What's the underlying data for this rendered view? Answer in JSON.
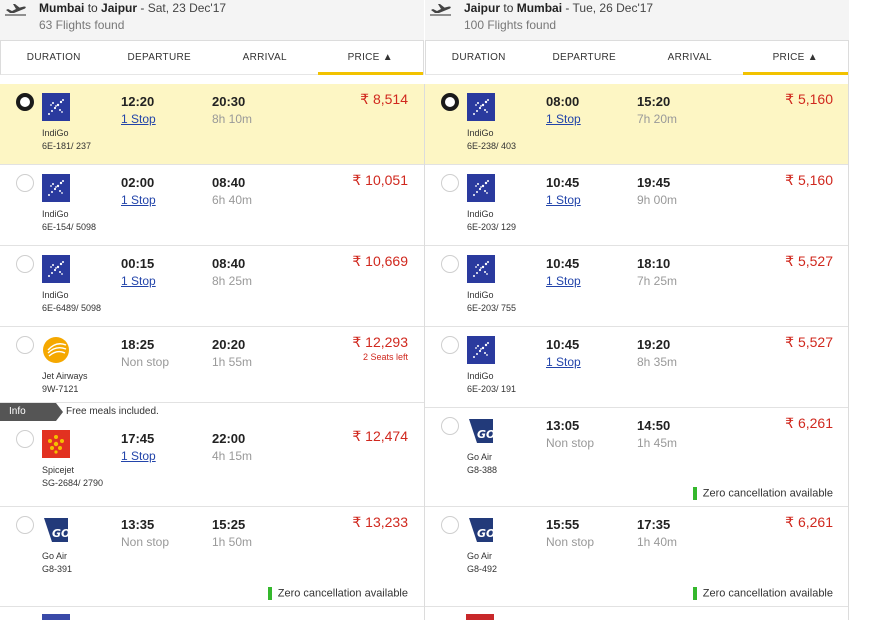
{
  "outbound": {
    "from": "Mumbai",
    "connector": "to",
    "to": "Jaipur",
    "date": "Sat, 23 Dec'17",
    "count": "63 Flights found",
    "sort": [
      "DURATION",
      "DEPARTURE",
      "ARRIVAL",
      "PRICE ▲"
    ],
    "flights": [
      {
        "airline": "IndiGo",
        "flight": "6E-181/ 237",
        "dep": "12:20",
        "arr": "20:30",
        "stops": "1 Stop",
        "dur": "8h 10m",
        "price": "₹ 8,514",
        "selected": true,
        "logo": "indigo"
      },
      {
        "airline": "IndiGo",
        "flight": "6E-154/ 5098",
        "dep": "02:00",
        "arr": "08:40",
        "stops": "1 Stop",
        "dur": "6h 40m",
        "price": "₹ 10,051",
        "logo": "indigo"
      },
      {
        "airline": "IndiGo",
        "flight": "6E-6489/ 5098",
        "dep": "00:15",
        "arr": "08:40",
        "stops": "1 Stop",
        "dur": "8h 25m",
        "price": "₹ 10,669",
        "logo": "indigo"
      },
      {
        "airline": "Jet Airways",
        "flight": "9W-7121",
        "dep": "18:25",
        "arr": "20:20",
        "stops": "Non stop",
        "dur": "1h 55m",
        "price": "₹ 12,293",
        "seats": "2 Seats left",
        "logo": "jet"
      },
      {
        "airline": "Spicejet",
        "flight": "SG-2684/ 2790",
        "dep": "17:45",
        "arr": "22:00",
        "stops": "1 Stop",
        "dur": "4h 15m",
        "price": "₹ 12,474",
        "logo": "spice"
      },
      {
        "airline": "Go Air",
        "flight": "G8-391",
        "dep": "13:35",
        "arr": "15:25",
        "stops": "Non stop",
        "dur": "1h 50m",
        "price": "₹ 13,233",
        "zero": "Zero cancellation available",
        "logo": "goair"
      }
    ],
    "info_tag": "Info",
    "info_msg": "Free meals included."
  },
  "return": {
    "from": "Jaipur",
    "connector": "to",
    "to": "Mumbai",
    "date": "Tue, 26 Dec'17",
    "count": "100 Flights found",
    "sort": [
      "DURATION",
      "DEPARTURE",
      "ARRIVAL",
      "PRICE ▲"
    ],
    "flights": [
      {
        "airline": "IndiGo",
        "flight": "6E-238/ 403",
        "dep": "08:00",
        "arr": "15:20",
        "stops": "1 Stop",
        "dur": "7h 20m",
        "price": "₹ 5,160",
        "selected": true,
        "logo": "indigo"
      },
      {
        "airline": "IndiGo",
        "flight": "6E-203/ 129",
        "dep": "10:45",
        "arr": "19:45",
        "stops": "1 Stop",
        "dur": "9h 00m",
        "price": "₹ 5,160",
        "logo": "indigo"
      },
      {
        "airline": "IndiGo",
        "flight": "6E-203/ 755",
        "dep": "10:45",
        "arr": "18:10",
        "stops": "1 Stop",
        "dur": "7h 25m",
        "price": "₹ 5,527",
        "logo": "indigo"
      },
      {
        "airline": "IndiGo",
        "flight": "6E-203/ 191",
        "dep": "10:45",
        "arr": "19:20",
        "stops": "1 Stop",
        "dur": "8h 35m",
        "price": "₹ 5,527",
        "logo": "indigo"
      },
      {
        "airline": "Go Air",
        "flight": "G8-388",
        "dep": "13:05",
        "arr": "14:50",
        "stops": "Non stop",
        "dur": "1h 45m",
        "price": "₹ 6,261",
        "zero": "Zero cancellation available",
        "logo": "goair"
      },
      {
        "airline": "Go Air",
        "flight": "G8-492",
        "dep": "15:55",
        "arr": "17:35",
        "stops": "Non stop",
        "dur": "1h 40m",
        "price": "₹ 6,261",
        "zero": "Zero cancellation available",
        "logo": "goair"
      }
    ]
  },
  "colors": {
    "price": "#d0281e",
    "selected_bg": "#fdf6c4",
    "sort_accent": "#f2c200",
    "zero_bar": "#35b82d",
    "indigo": "#2a3a9e",
    "goair": "#223a7a",
    "spice": "#e23120",
    "jet": "#f5a800"
  }
}
